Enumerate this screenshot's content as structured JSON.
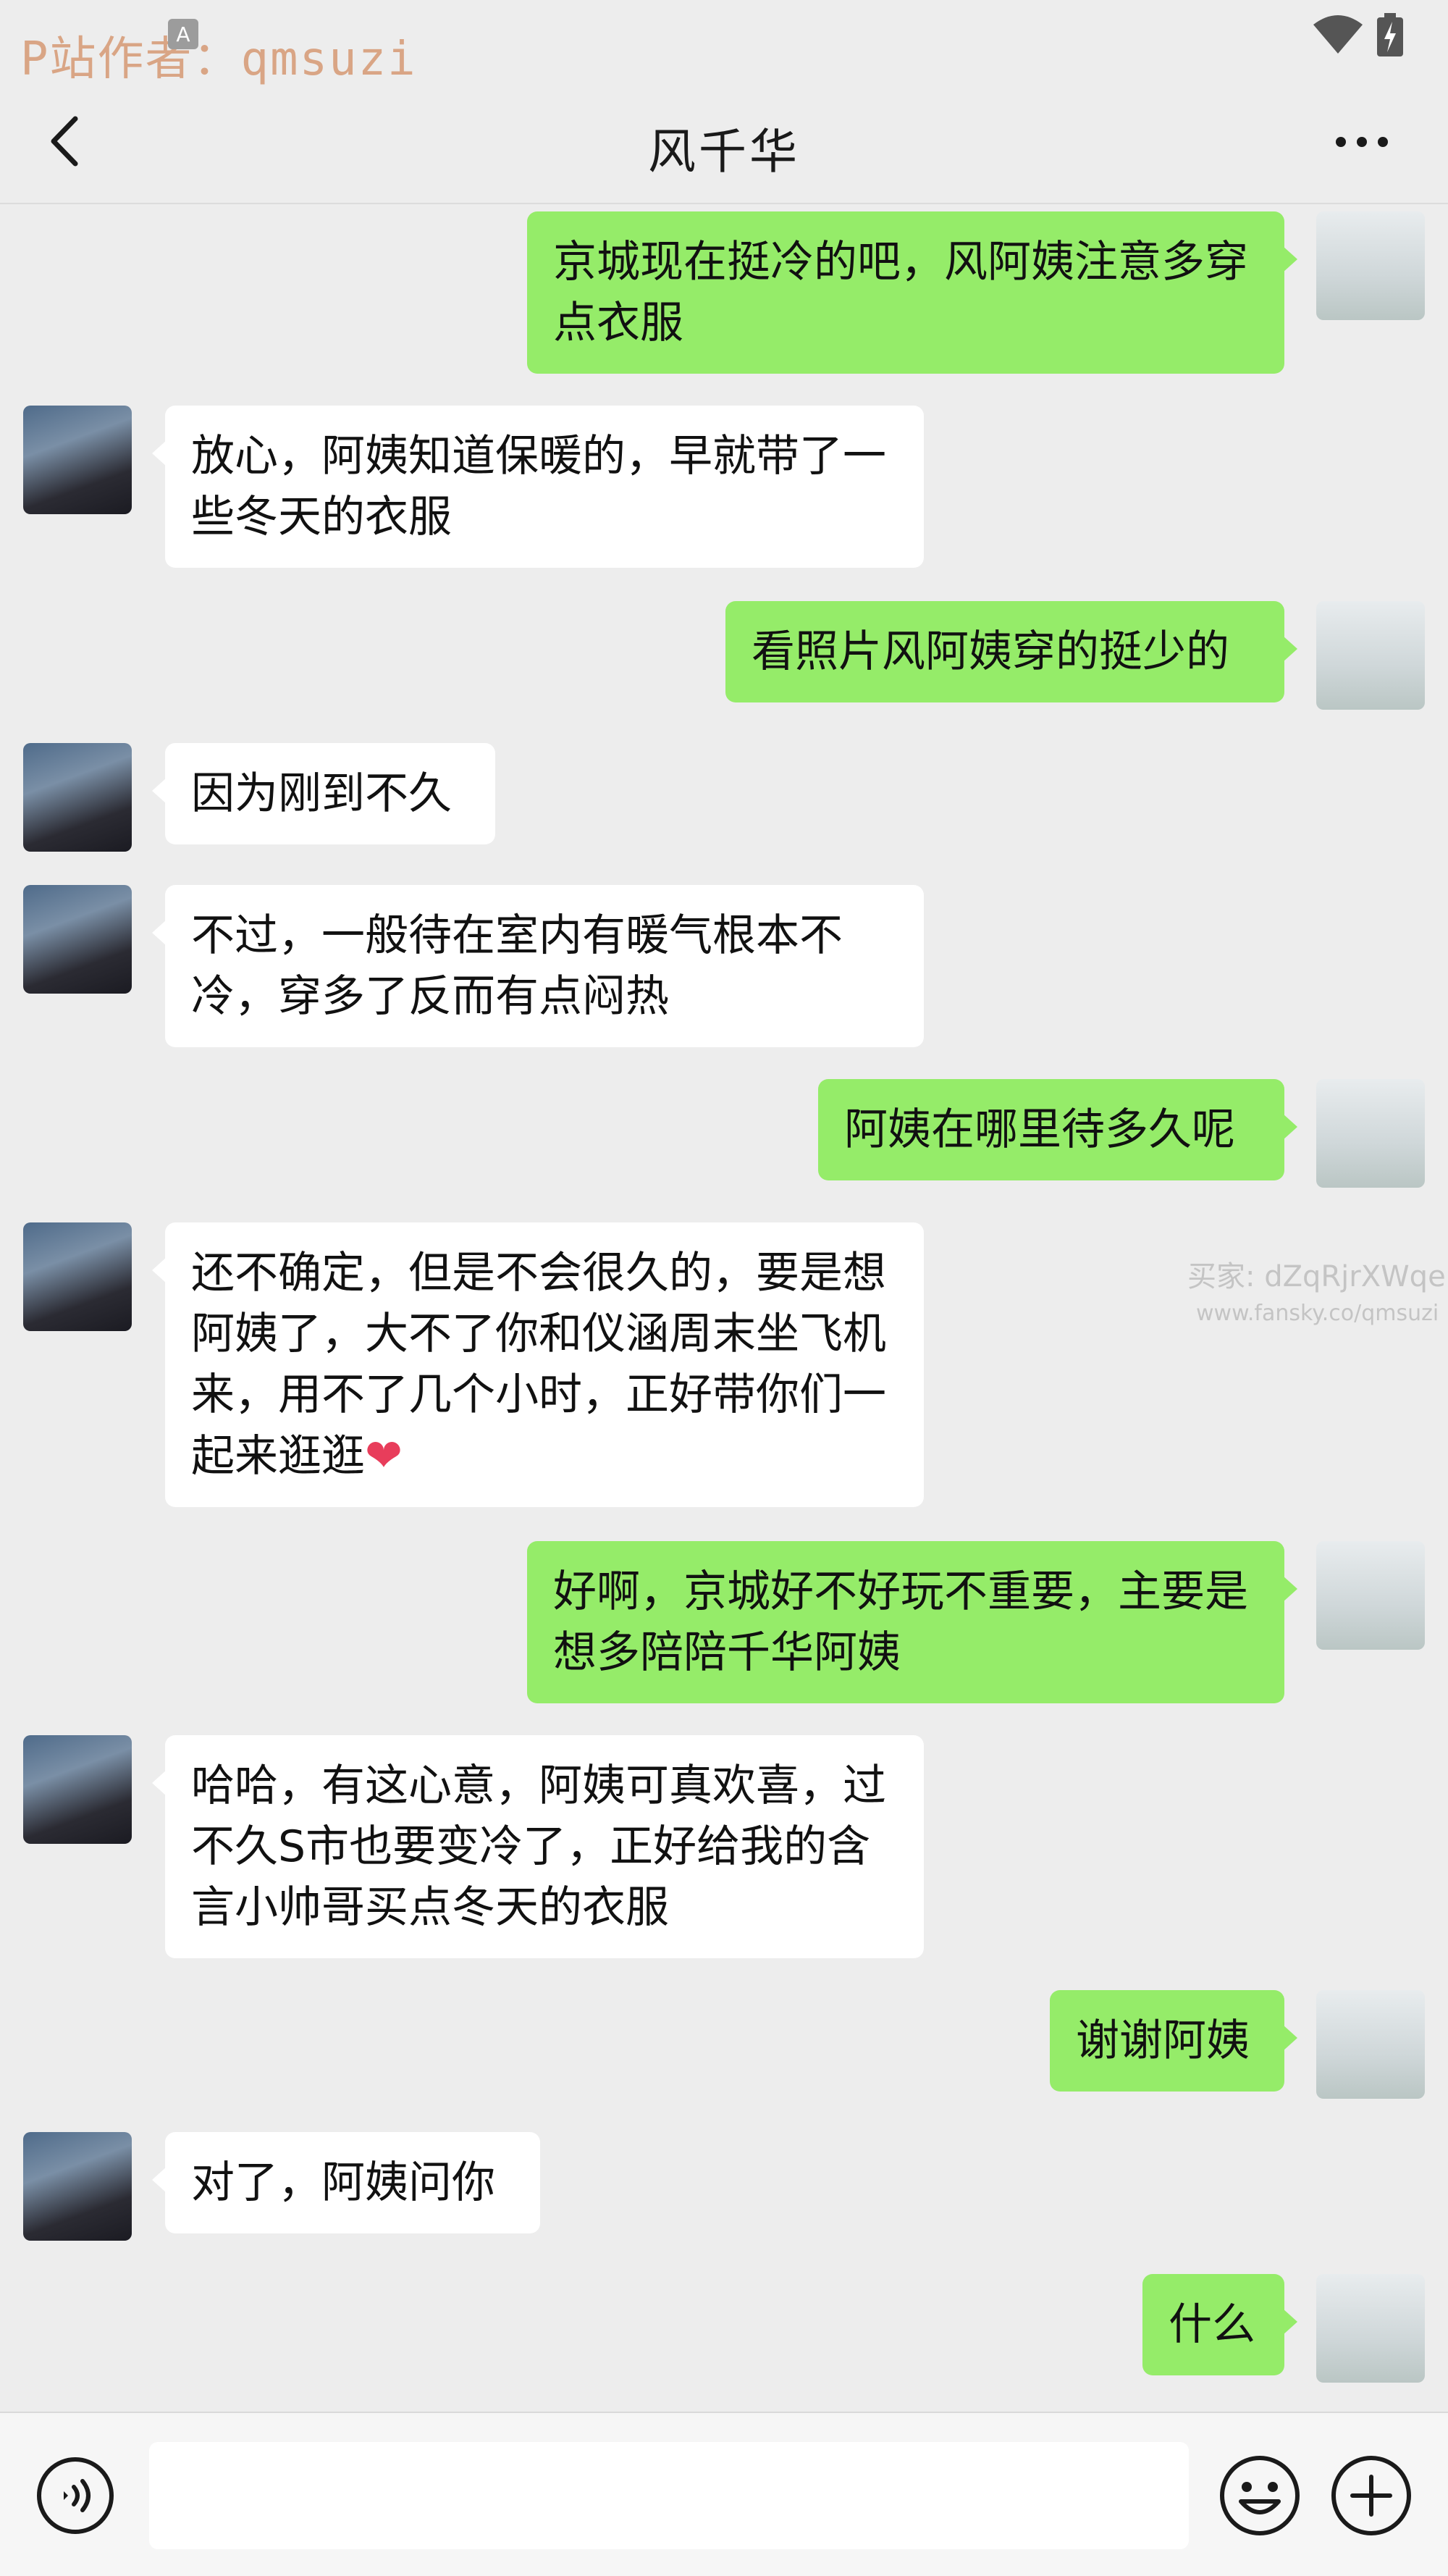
{
  "status_bar": {
    "watermark": "P站作者：qmsuzi",
    "small_icon_letter": "A"
  },
  "header": {
    "title": "风千华"
  },
  "messages": [
    {
      "side": "right",
      "text": "京城现在挺冷的吧，风阿姨注意多穿点衣服"
    },
    {
      "side": "left",
      "text": "放心，阿姨知道保暖的，早就带了一些冬天的衣服"
    },
    {
      "side": "right",
      "text": "看照片风阿姨穿的挺少的"
    },
    {
      "side": "left",
      "text": "因为刚到不久"
    },
    {
      "side": "left",
      "text": "不过，一般待在室内有暖气根本不冷，穿多了反而有点闷热"
    },
    {
      "side": "right",
      "text": "阿姨在哪里待多久呢"
    },
    {
      "side": "left",
      "text": "还不确定，但是不会很久的，要是想阿姨了，大不了你和仪涵周末坐飞机来，用不了几个小时，正好带你们一起来逛逛",
      "emoji": "❤"
    },
    {
      "side": "right",
      "text": "好啊，京城好不好玩不重要，主要是想多陪陪千华阿姨"
    },
    {
      "side": "left",
      "text": "哈哈，有这心意，阿姨可真欢喜，过不久S市也要变冷了，正好给我的含言小帅哥买点冬天的衣服"
    },
    {
      "side": "right",
      "text": "谢谢阿姨"
    },
    {
      "side": "left",
      "text": "对了，阿姨问你"
    },
    {
      "side": "right",
      "text": "什么"
    }
  ],
  "watermark_mid": {
    "line1": "买家: dZqRjrXWqe",
    "line2": "www.fansky.co/qmsuzi"
  },
  "input_bar": {
    "value": ""
  },
  "icons": {
    "back": "chevron-left-icon",
    "more": "more-dots-icon",
    "voice": "voice-icon",
    "emoji": "emoji-icon",
    "plus": "plus-icon",
    "wifi": "wifi-icon",
    "battery": "battery-charging-icon"
  },
  "colors": {
    "background": "#ededed",
    "bubble_me": "#95ec69",
    "bubble_other": "#ffffff",
    "watermark": "#d9a585"
  }
}
